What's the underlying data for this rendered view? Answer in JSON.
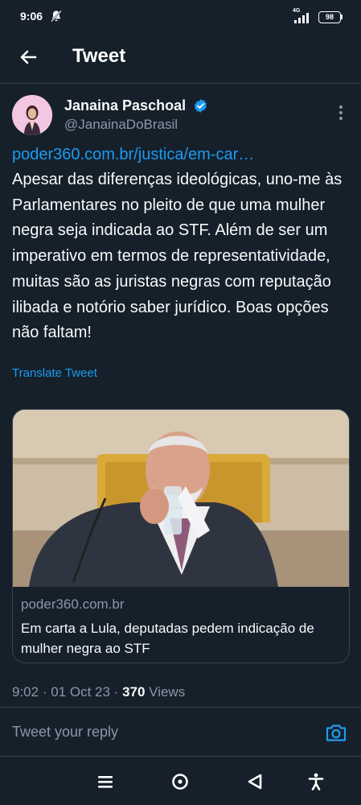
{
  "status_bar": {
    "time": "9:06",
    "network": "4G",
    "battery": "98",
    "icons": [
      "bell-off-icon",
      "signal-icon",
      "battery-icon"
    ]
  },
  "header": {
    "title": "Tweet",
    "back_icon": "arrow-left-icon"
  },
  "tweet": {
    "author_name": "Janaina Paschoal",
    "author_handle": "@JanainaDoBrasil",
    "verified": true,
    "link": "poder360.com.br/justica/em-car…",
    "body": "Apesar das diferenças ideológicas, uno-me às Parlamentares no pleito de que uma mulher negra seja indicada ao STF. Além de ser um imperativo em termos de representatividade, muitas são as juristas negras com reputação ilibada e notório saber jurídico. Boas opções não faltam!",
    "translate_label": "Translate Tweet",
    "card": {
      "domain": "poder360.com.br",
      "title": "Em carta a Lula, deputadas pedem indicação de mulher negra ao STF"
    },
    "time": "9:02",
    "date": "01 Oct 23",
    "views_count": "370",
    "views_label": "Views"
  },
  "reply": {
    "placeholder": "Tweet your reply"
  },
  "colors": {
    "background": "#15202b",
    "accent": "#1d9bf0",
    "secondary_text": "#8b98a5",
    "divider": "#38444d"
  },
  "navbar_icons": [
    "menu-icon",
    "home-circle-icon",
    "back-triangle-icon",
    "accessibility-icon"
  ]
}
